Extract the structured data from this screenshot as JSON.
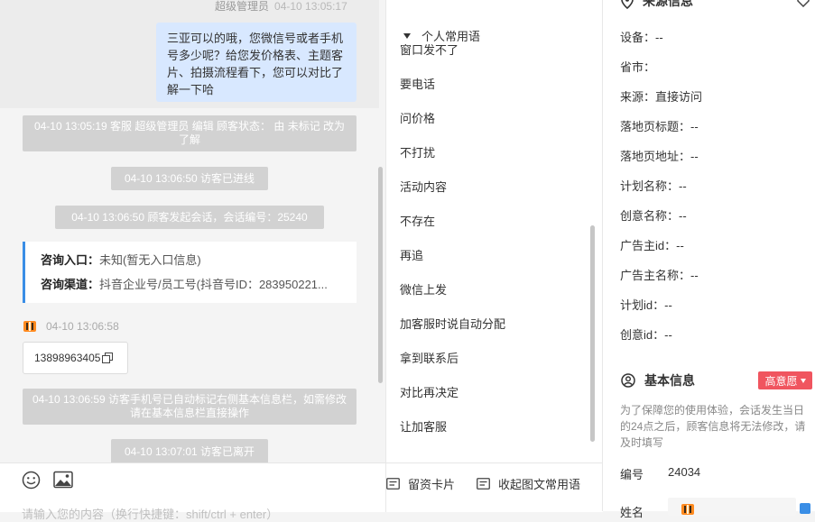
{
  "chat": {
    "top_sender": "超级管理员",
    "top_time": "04-10 13:05:17",
    "agent_message": "三亚可以的哦，您微信号或者手机号多少呢？给您发价格表、主题客片、拍摄流程看下，您可以对比了解一下哈",
    "system_msgs": [
      "04-10 13:05:19 客服 超级管理员 编辑 顾客状态： 由 未标记 改为 了解",
      "04-10 13:06:50 访客已进线",
      "04-10 13:06:50 顾客发起会话，会话编号：25240",
      "04-10 13:06:59 访客手机号已自动标记右侧基本信息栏，如需修改请在基本信息栏直接操作",
      "04-10 13:07:01 访客已离开"
    ],
    "info_card": {
      "entry_label": "咨询入口：",
      "entry_value": "未知(暂无入口信息)",
      "channel_label": "咨询渠道：",
      "channel_value": "抖音企业号/员工号(抖音号ID：283950221..."
    },
    "visitor_time": "04-10 13:06:58",
    "phone": "13898963405",
    "input_placeholder": "请输入您的内容（换行快捷键：shift/ctrl + enter）"
  },
  "phrases": {
    "group_title": "个人常用语",
    "items": [
      "窗口发不了",
      "要电话",
      "问价格",
      "不打扰",
      "活动内容",
      "不存在",
      "再追",
      "微信上发",
      "加客服时说自动分配",
      "拿到联系后",
      "对比再决定",
      "让加客服"
    ]
  },
  "bottom_actions": {
    "leave_card": "留资卡片",
    "collapse_phrases": "收起图文常用语"
  },
  "source_info": {
    "title": "来源信息",
    "fields": [
      {
        "label": "设备：",
        "value": "--"
      },
      {
        "label": "省市：",
        "value": ""
      },
      {
        "label": "来源：",
        "value": "直接访问"
      },
      {
        "label": "落地页标题：",
        "value": "--"
      },
      {
        "label": "落地页地址：",
        "value": "--"
      },
      {
        "label": "计划名称：",
        "value": "--"
      },
      {
        "label": "创意名称：",
        "value": "--"
      },
      {
        "label": "广告主id：",
        "value": "--"
      },
      {
        "label": "广告主名称：",
        "value": "--"
      },
      {
        "label": "计划id：",
        "value": "--"
      },
      {
        "label": "创意id：",
        "value": "--"
      }
    ]
  },
  "basic_info": {
    "title": "基本信息",
    "intent_badge": "高意愿",
    "notice": "为了保障您的使用体验，会话发生当日的24点之后，顾客信息将无法修改，请及时填写",
    "id_label": "编号",
    "id_value": "24034",
    "name_label": "姓名"
  },
  "colors": {
    "accent_blue": "#3a8ee6",
    "bubble_blue": "#d8e8ff",
    "system_gray": "#d2d2d2",
    "badge_red": "#f0555f"
  }
}
